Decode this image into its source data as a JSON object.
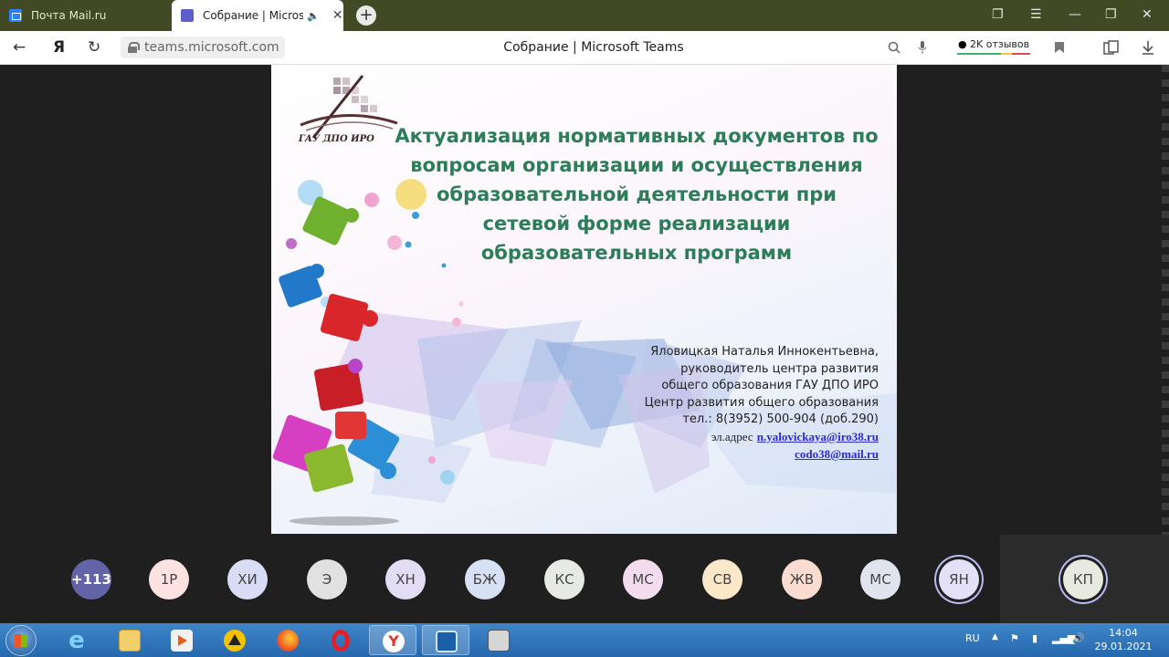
{
  "browser": {
    "tabs": [
      {
        "title": "Почта Mail.ru"
      },
      {
        "title": "Собрание | Microsoft Teams"
      }
    ],
    "address": {
      "host": "teams.microsoft.com",
      "page_title": "Собрание | Microsoft Teams"
    },
    "reviews": "2K отзывов",
    "nav_glyphs": {
      "back": "←",
      "yandex": "Я",
      "reload": "↻"
    }
  },
  "slide": {
    "logo_text": "ГАУ ДПО ИРО",
    "title_lines": [
      "Актуализация нормативных документов по",
      "вопросам организации и осуществления",
      "образовательной деятельности при",
      "сетевой форме реализации",
      "образовательных программ"
    ],
    "contact": {
      "name": "Яловицкая Наталья Иннокентьевна,",
      "role1": "руководитель центра развития",
      "role2": "общего образования ГАУ ДПО ИРО",
      "center": "Центр развития общего образования",
      "phone": "тел.: 8(3952) 500-904 (доб.290)",
      "email_prefix": "эл.адрес",
      "email1": "n.yalovickaya@iro38.ru",
      "email2": "codo38@mail.ru"
    }
  },
  "participants": [
    {
      "label": "+113",
      "color": "#6264a7"
    },
    {
      "label": "1Р",
      "color": "#fde2e2"
    },
    {
      "label": "ХИ",
      "color": "#d8dcf4"
    },
    {
      "label": "Э",
      "color": "#e1e1e1"
    },
    {
      "label": "ХН",
      "color": "#e2dcf5"
    },
    {
      "label": "БЖ",
      "color": "#d6e1f5"
    },
    {
      "label": "КС",
      "color": "#e6e9e4"
    },
    {
      "label": "МС",
      "color": "#f3dcee"
    },
    {
      "label": "СВ",
      "color": "#fae8c9"
    },
    {
      "label": "ЖВ",
      "color": "#fbdcd0"
    },
    {
      "label": "МС",
      "color": "#dfe4ef"
    },
    {
      "label": "ЯН",
      "color": "#e4e0f7"
    },
    {
      "label": "КП",
      "color": "#e8eadf"
    }
  ],
  "taskbar": {
    "language": "RU",
    "time": "14:04",
    "date": "29.01.2021"
  }
}
